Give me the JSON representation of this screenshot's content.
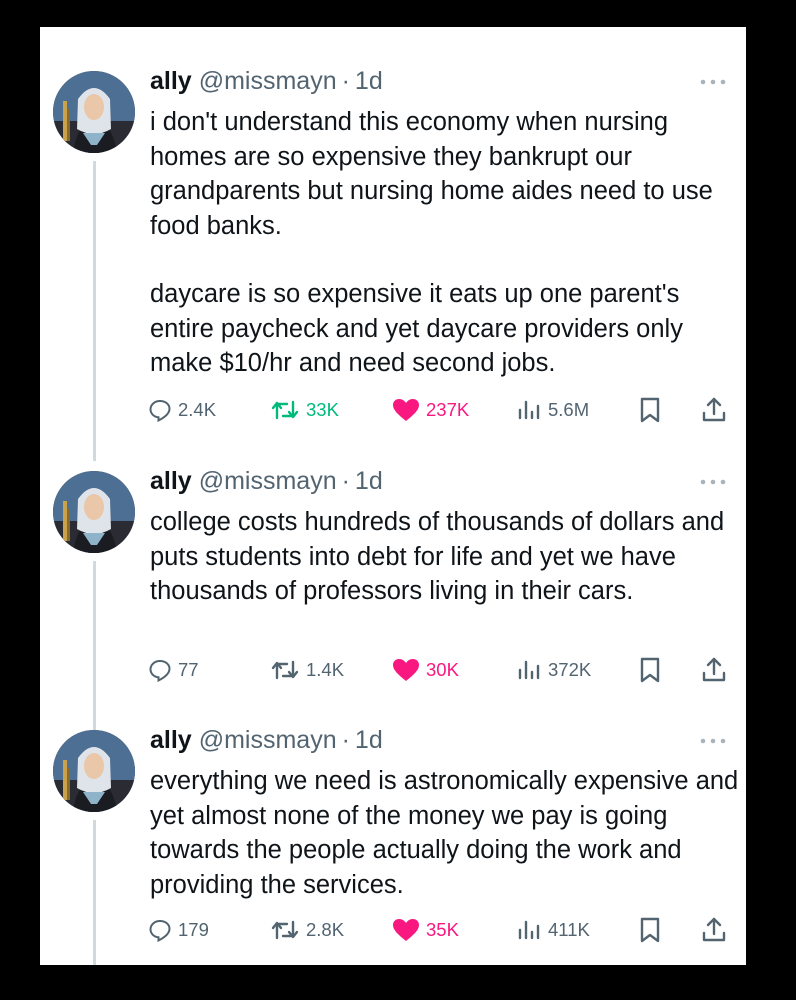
{
  "tweets": [
    {
      "name": "ally",
      "handle": "@missmayn",
      "separator": "·",
      "time": "1d",
      "paragraphs": [
        "i don't understand this economy when nursing homes are so expensive they bankrupt our grandparents but nursing home aides need to use food banks.",
        "daycare is so expensive it eats up one parent's entire paycheck and yet daycare providers only make $10/hr and need second jobs."
      ],
      "replies": "2.4K",
      "reposts": "33K",
      "likes": "237K",
      "views": "5.6M",
      "liked": true,
      "reposted": true
    },
    {
      "name": "ally",
      "handle": "@missmayn",
      "separator": "·",
      "time": "1d",
      "paragraphs": [
        "college costs hundreds of thousands of dollars and puts students into debt for life and yet we have thousands of professors living in their cars."
      ],
      "replies": "77",
      "reposts": "1.4K",
      "likes": "30K",
      "views": "372K",
      "liked": true,
      "reposted": false
    },
    {
      "name": "ally",
      "handle": "@missmayn",
      "separator": "·",
      "time": "1d",
      "paragraphs": [
        "everything we need is astronomically expensive and yet almost none of the money we pay is going towards the people actually doing the work and providing the services."
      ],
      "replies": "179",
      "reposts": "2.8K",
      "likes": "35K",
      "views": "411K",
      "liked": true,
      "reposted": false
    }
  ],
  "icons": {
    "reply": "reply-icon",
    "repost": "repost-icon",
    "like": "heart-icon",
    "views": "views-icon",
    "bookmark": "bookmark-icon",
    "share": "share-icon",
    "more": "more-icon"
  },
  "colors": {
    "text": "#0f1419",
    "muted": "#536471",
    "repost_active": "#00ba7c",
    "like_active": "#f91880",
    "thread_line": "#cfd9de"
  }
}
